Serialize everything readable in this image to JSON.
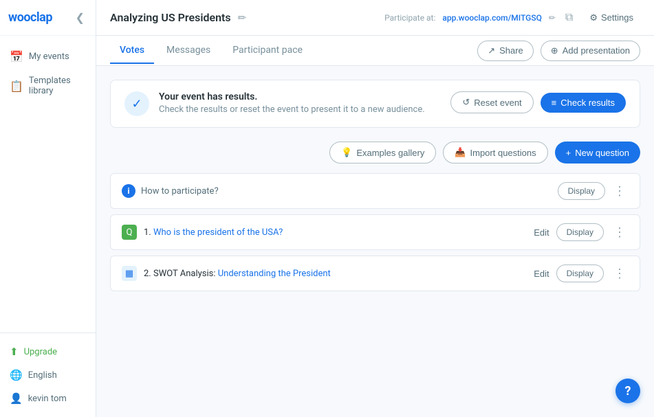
{
  "sidebar": {
    "logo": "wooclap",
    "collapse_icon": "❮",
    "nav_items": [
      {
        "id": "my-events",
        "label": "My events",
        "icon": "📅"
      },
      {
        "id": "templates-library",
        "label": "Templates library",
        "icon": "📋"
      }
    ],
    "bottom_items": [
      {
        "id": "upgrade",
        "label": "Upgrade",
        "icon": "⬆",
        "accent": true
      },
      {
        "id": "language",
        "label": "English",
        "icon": "🌐"
      },
      {
        "id": "user",
        "label": "kevin tom",
        "icon": "👤"
      }
    ]
  },
  "header": {
    "title": "Analyzing US Presidents",
    "edit_icon": "✏",
    "participate_label": "Participate at:",
    "participate_url": "app.wooclap.com/MITGSQ",
    "url_edit_icon": "✏",
    "copy_icon": "⧉",
    "settings_label": "Settings",
    "settings_icon": "⚙"
  },
  "tabs": {
    "items": [
      {
        "id": "votes",
        "label": "Votes",
        "active": true
      },
      {
        "id": "messages",
        "label": "Messages",
        "active": false
      },
      {
        "id": "participant-pace",
        "label": "Participant pace",
        "active": false
      }
    ],
    "share_label": "Share",
    "add_presentation_label": "Add presentation"
  },
  "banner": {
    "icon": "✓",
    "title": "Your event has results.",
    "subtitle": "Check the results or reset the event to present it to a new audience.",
    "reset_label": "Reset event",
    "reset_icon": "↺",
    "check_results_label": "Check results",
    "check_results_icon": "≡"
  },
  "toolbar": {
    "examples_label": "Examples gallery",
    "examples_icon": "💡",
    "import_label": "Import questions",
    "import_icon": "📥",
    "new_question_label": "New question",
    "new_question_icon": "+"
  },
  "how_to": {
    "icon": "i",
    "label": "How to participate?",
    "display_label": "Display",
    "more_icon": "⋮"
  },
  "questions": [
    {
      "number": "1.",
      "icon": "Q",
      "icon_type": "green",
      "text": "Who is the president of the USA?",
      "edit_label": "Edit",
      "display_label": "Display",
      "more_icon": "⋮"
    },
    {
      "number": "2.",
      "icon": "▦",
      "icon_type": "blue",
      "text_prefix": "SWOT Analysis: ",
      "text_link": "Understanding the President",
      "edit_label": "Edit",
      "display_label": "Display",
      "more_icon": "⋮"
    }
  ],
  "help": {
    "icon": "?"
  }
}
